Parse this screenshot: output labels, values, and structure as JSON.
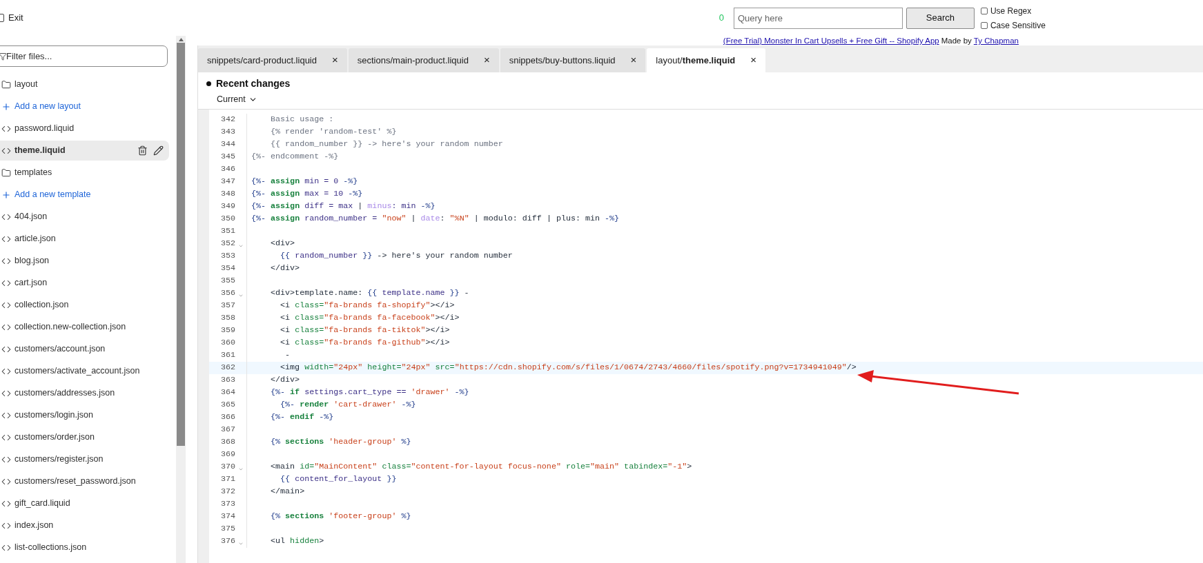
{
  "topbar": {
    "exit_label": "Exit",
    "match_count": "0",
    "query": {
      "placeholder": "Query here"
    },
    "search_button": "Search",
    "options": [
      {
        "label": "Use Regex",
        "checked": false
      },
      {
        "label": "Case Sensitive",
        "checked": false
      }
    ]
  },
  "banner": {
    "app_link": "(Free Trial) Monster In Cart Upsells + Free Gift -- Shopify App",
    "made_by": "Made by",
    "author_link": "Ty Chapman"
  },
  "sidebar": {
    "filter": {
      "placeholder": "Filter files..."
    },
    "items": [
      {
        "kind": "folder",
        "label": "layout",
        "selected": false
      },
      {
        "kind": "add",
        "label": "Add a new layout",
        "selected": false
      },
      {
        "kind": "file",
        "label": "password.liquid",
        "selected": false
      },
      {
        "kind": "file",
        "label": "theme.liquid",
        "selected": true
      },
      {
        "kind": "folder",
        "label": "templates",
        "selected": false
      },
      {
        "kind": "add",
        "label": "Add a new template",
        "selected": false
      },
      {
        "kind": "file",
        "label": "404.json",
        "selected": false
      },
      {
        "kind": "file",
        "label": "article.json",
        "selected": false
      },
      {
        "kind": "file",
        "label": "blog.json",
        "selected": false
      },
      {
        "kind": "file",
        "label": "cart.json",
        "selected": false
      },
      {
        "kind": "file",
        "label": "collection.json",
        "selected": false
      },
      {
        "kind": "file",
        "label": "collection.new-collection.json",
        "selected": false
      },
      {
        "kind": "file",
        "label": "customers/account.json",
        "selected": false
      },
      {
        "kind": "file",
        "label": "customers/activate_account.json",
        "selected": false
      },
      {
        "kind": "file",
        "label": "customers/addresses.json",
        "selected": false
      },
      {
        "kind": "file",
        "label": "customers/login.json",
        "selected": false
      },
      {
        "kind": "file",
        "label": "customers/order.json",
        "selected": false
      },
      {
        "kind": "file",
        "label": "customers/register.json",
        "selected": false
      },
      {
        "kind": "file",
        "label": "customers/reset_password.json",
        "selected": false
      },
      {
        "kind": "file",
        "label": "gift_card.liquid",
        "selected": false
      },
      {
        "kind": "file",
        "label": "index.json",
        "selected": false
      },
      {
        "kind": "file",
        "label": "list-collections.json",
        "selected": false
      }
    ]
  },
  "tabs": [
    {
      "label": "snippets/card-product.liquid",
      "close": "×",
      "selected": false
    },
    {
      "label": "sections/main-product.liquid",
      "close": "×",
      "selected": false
    },
    {
      "label": "snippets/buy-buttons.liquid",
      "close": "×",
      "selected": false
    },
    {
      "label": "layout/**theme.liquid**",
      "close": "×",
      "selected": true
    }
  ],
  "recent_changes": {
    "title": "Recent changes",
    "version": "Current"
  },
  "code": [
    {
      "number": "342",
      "fold": false,
      "highlighted": false,
      "tokens": [
        {
          "t": "    Basic usage :",
          "kind": "comment"
        }
      ]
    },
    {
      "number": "343",
      "fold": false,
      "highlighted": false,
      "tokens": [
        {
          "t": "    {% render 'random-test' %}",
          "kind": "comment"
        }
      ]
    },
    {
      "number": "344",
      "fold": false,
      "highlighted": false,
      "tokens": [
        {
          "t": "    {{ random_number }} -> here's your random number",
          "kind": "comment"
        }
      ]
    },
    {
      "number": "345",
      "fold": false,
      "highlighted": false,
      "tokens": [
        {
          "t": "{%- endcomment -%}",
          "kind": "comment"
        }
      ]
    },
    {
      "number": "346",
      "fold": false,
      "highlighted": false
    },
    {
      "number": "347",
      "fold": false,
      "highlighted": false,
      "tokens": [
        {
          "t": "{%- ",
          "kind": "delim"
        },
        {
          "t": "assign",
          "kind": "keyword"
        },
        {
          "t": " min = 0 ",
          "kind": "var"
        },
        {
          "t": "-%}",
          "kind": "delim"
        }
      ]
    },
    {
      "number": "348",
      "fold": false,
      "highlighted": false,
      "tokens": [
        {
          "t": "{%- ",
          "kind": "delim"
        },
        {
          "t": "assign",
          "kind": "keyword"
        },
        {
          "t": " max = 10 ",
          "kind": "var"
        },
        {
          "t": "-%}",
          "kind": "delim"
        }
      ]
    },
    {
      "number": "349",
      "fold": false,
      "highlighted": false,
      "tokens": [
        {
          "t": "{%- ",
          "kind": "delim"
        },
        {
          "t": "assign",
          "kind": "keyword"
        },
        {
          "t": " diff = max ",
          "kind": "var"
        },
        {
          "t": "| ",
          "kind": "plain"
        },
        {
          "t": "minus",
          "kind": "filter"
        },
        {
          "t": ": min ",
          "kind": "var"
        },
        {
          "t": "-%}",
          "kind": "delim"
        }
      ]
    },
    {
      "number": "350",
      "fold": false,
      "highlighted": false,
      "tokens": [
        {
          "t": "{%- ",
          "kind": "delim"
        },
        {
          "t": "assign",
          "kind": "keyword"
        },
        {
          "t": " random_number = ",
          "kind": "var"
        },
        {
          "t": "\"now\"",
          "kind": "string"
        },
        {
          "t": " | ",
          "kind": "plain"
        },
        {
          "t": "date",
          "kind": "filter"
        },
        {
          "t": ": ",
          "kind": "plain"
        },
        {
          "t": "\"%N\"",
          "kind": "string"
        },
        {
          "t": " | modulo: diff | plus: min ",
          "kind": "plain"
        },
        {
          "t": "-%}",
          "kind": "delim"
        }
      ]
    },
    {
      "number": "351",
      "fold": false,
      "highlighted": false
    },
    {
      "number": "352",
      "fold": true,
      "highlighted": false,
      "tokens": [
        {
          "t": "    <div>",
          "kind": "plain"
        }
      ]
    },
    {
      "number": "353",
      "fold": false,
      "highlighted": false,
      "tokens": [
        {
          "t": "      {{ ",
          "kind": "delim"
        },
        {
          "t": "random_number",
          "kind": "var"
        },
        {
          "t": " }}",
          "kind": "delim"
        },
        {
          "t": " -> here's your random number",
          "kind": "plain"
        }
      ]
    },
    {
      "number": "354",
      "fold": false,
      "highlighted": false,
      "tokens": [
        {
          "t": "    </div>",
          "kind": "plain"
        }
      ]
    },
    {
      "number": "355",
      "fold": false,
      "highlighted": false
    },
    {
      "number": "356",
      "fold": true,
      "highlighted": false,
      "tokens": [
        {
          "t": "    <div>template.name: ",
          "kind": "plain"
        },
        {
          "t": "{{ ",
          "kind": "delim"
        },
        {
          "t": "template.name",
          "kind": "var"
        },
        {
          "t": " }}",
          "kind": "delim"
        },
        {
          "t": " -",
          "kind": "plain"
        }
      ]
    },
    {
      "number": "357",
      "fold": false,
      "highlighted": false,
      "tokens": [
        {
          "t": "      <i ",
          "kind": "plain"
        },
        {
          "t": "class=",
          "kind": "attr"
        },
        {
          "t": "\"fa-brands fa-shopify\"",
          "kind": "string"
        },
        {
          "t": "></i>",
          "kind": "plain"
        }
      ]
    },
    {
      "number": "358",
      "fold": false,
      "highlighted": false,
      "tokens": [
        {
          "t": "      <i ",
          "kind": "plain"
        },
        {
          "t": "class=",
          "kind": "attr"
        },
        {
          "t": "\"fa-brands fa-facebook\"",
          "kind": "string"
        },
        {
          "t": "></i>",
          "kind": "plain"
        }
      ]
    },
    {
      "number": "359",
      "fold": false,
      "highlighted": false,
      "tokens": [
        {
          "t": "      <i ",
          "kind": "plain"
        },
        {
          "t": "class=",
          "kind": "attr"
        },
        {
          "t": "\"fa-brands fa-tiktok\"",
          "kind": "string"
        },
        {
          "t": "></i>",
          "kind": "plain"
        }
      ]
    },
    {
      "number": "360",
      "fold": false,
      "highlighted": false,
      "tokens": [
        {
          "t": "      <i ",
          "kind": "plain"
        },
        {
          "t": "class=",
          "kind": "attr"
        },
        {
          "t": "\"fa-brands fa-github\"",
          "kind": "string"
        },
        {
          "t": "></i>",
          "kind": "plain"
        }
      ]
    },
    {
      "number": "361",
      "fold": false,
      "highlighted": false,
      "tokens": [
        {
          "t": "       -",
          "kind": "plain"
        }
      ]
    },
    {
      "number": "362",
      "fold": false,
      "highlighted": true,
      "tokens": [
        {
          "t": "      <img ",
          "kind": "plain"
        },
        {
          "t": "width=",
          "kind": "attr"
        },
        {
          "t": "\"24px\"",
          "kind": "string"
        },
        {
          "t": " height=",
          "kind": "attr"
        },
        {
          "t": "\"24px\"",
          "kind": "string"
        },
        {
          "t": " src=",
          "kind": "attr"
        },
        {
          "t": "\"https://cdn.shopify.com/s/files/1/0674/2743/4660/files/spotify.png?v=1734941049\"",
          "kind": "string"
        },
        {
          "t": "/>",
          "kind": "plain"
        }
      ]
    },
    {
      "number": "363",
      "fold": false,
      "highlighted": false,
      "tokens": [
        {
          "t": "    </div>",
          "kind": "plain"
        }
      ]
    },
    {
      "number": "364",
      "fold": false,
      "highlighted": false,
      "tokens": [
        {
          "t": "    {%- ",
          "kind": "delim"
        },
        {
          "t": "if",
          "kind": "keyword"
        },
        {
          "t": " settings.cart_type == ",
          "kind": "var"
        },
        {
          "t": "'drawer'",
          "kind": "string"
        },
        {
          "t": " -%}",
          "kind": "delim"
        }
      ]
    },
    {
      "number": "365",
      "fold": false,
      "highlighted": false,
      "tokens": [
        {
          "t": "      {%- ",
          "kind": "delim"
        },
        {
          "t": "render",
          "kind": "keyword"
        },
        {
          "t": " 'cart-drawer'",
          "kind": "string"
        },
        {
          "t": " -%}",
          "kind": "delim"
        }
      ]
    },
    {
      "number": "366",
      "fold": false,
      "highlighted": false,
      "tokens": [
        {
          "t": "    {%- ",
          "kind": "delim"
        },
        {
          "t": "endif",
          "kind": "keyword"
        },
        {
          "t": " -%}",
          "kind": "delim"
        }
      ]
    },
    {
      "number": "367",
      "fold": false,
      "highlighted": false
    },
    {
      "number": "368",
      "fold": false,
      "highlighted": false,
      "tokens": [
        {
          "t": "    {% ",
          "kind": "delim"
        },
        {
          "t": "sections",
          "kind": "keyword"
        },
        {
          "t": " 'header-group'",
          "kind": "string"
        },
        {
          "t": " %}",
          "kind": "delim"
        }
      ]
    },
    {
      "number": "369",
      "fold": false,
      "highlighted": false
    },
    {
      "number": "370",
      "fold": true,
      "highlighted": false,
      "tokens": [
        {
          "t": "    <main ",
          "kind": "plain"
        },
        {
          "t": "id=",
          "kind": "attr"
        },
        {
          "t": "\"MainContent\"",
          "kind": "string"
        },
        {
          "t": " class=",
          "kind": "attr"
        },
        {
          "t": "\"content-for-layout focus-none\"",
          "kind": "string"
        },
        {
          "t": " role=",
          "kind": "attr"
        },
        {
          "t": "\"main\"",
          "kind": "string"
        },
        {
          "t": " tabindex=",
          "kind": "attr"
        },
        {
          "t": "\"-1\"",
          "kind": "string"
        },
        {
          "t": ">",
          "kind": "plain"
        }
      ]
    },
    {
      "number": "371",
      "fold": false,
      "highlighted": false,
      "tokens": [
        {
          "t": "      {{ ",
          "kind": "delim"
        },
        {
          "t": "content_for_layout",
          "kind": "var"
        },
        {
          "t": " }}",
          "kind": "delim"
        }
      ]
    },
    {
      "number": "372",
      "fold": false,
      "highlighted": false,
      "tokens": [
        {
          "t": "    </main>",
          "kind": "plain"
        }
      ]
    },
    {
      "number": "373",
      "fold": false,
      "highlighted": false
    },
    {
      "number": "374",
      "fold": false,
      "highlighted": false,
      "tokens": [
        {
          "t": "    {% ",
          "kind": "delim"
        },
        {
          "t": "sections",
          "kind": "keyword"
        },
        {
          "t": " 'footer-group'",
          "kind": "string"
        },
        {
          "t": " %}",
          "kind": "delim"
        }
      ]
    },
    {
      "number": "375",
      "fold": false,
      "highlighted": false
    },
    {
      "number": "376",
      "fold": true,
      "highlighted": false,
      "tokens": [
        {
          "t": "    <ul ",
          "kind": "plain"
        },
        {
          "t": "hidden",
          "kind": "attr"
        },
        {
          "t": ">",
          "kind": "plain"
        }
      ]
    }
  ]
}
